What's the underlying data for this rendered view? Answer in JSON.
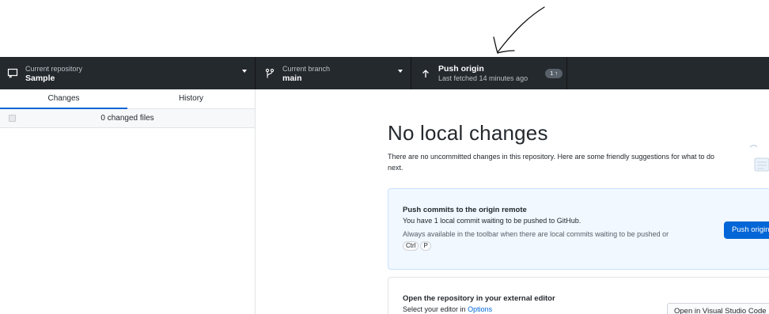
{
  "toolbar": {
    "repository": {
      "label": "Current repository",
      "value": "Sample",
      "icon": "repo-icon"
    },
    "branch": {
      "label": "Current branch",
      "value": "main",
      "icon": "branch-icon"
    },
    "push": {
      "label": "Push origin",
      "sublabel": "Last fetched 14 minutes ago",
      "badge": "1 ↑",
      "icon": "arrow-up-icon"
    }
  },
  "sidebar": {
    "tabs": [
      {
        "label": "Changes",
        "active": true
      },
      {
        "label": "History",
        "active": false
      }
    ],
    "changed_files": "0 changed files"
  },
  "main": {
    "heading": "No local changes",
    "intro": "There are no uncommitted changes in this repository. Here are some friendly suggestions for what to do next.",
    "push_card": {
      "title": "Push commits to the origin remote",
      "description": "You have 1 local commit waiting to be pushed to GitHub.",
      "hint": "Always available in the toolbar when there are local commits waiting to be pushed or",
      "shortcut_keys": [
        "Ctrl",
        "P"
      ],
      "button": "Push origin"
    },
    "editor_card": {
      "title": "Open the repository in your external editor",
      "description_prefix": "Select your editor in",
      "description_link": "Options",
      "button": "Open in Visual Studio Code"
    }
  },
  "colors": {
    "toolbar_bg": "#24292e",
    "accent": "#0366d6",
    "card_bg": "#f1f8ff"
  }
}
